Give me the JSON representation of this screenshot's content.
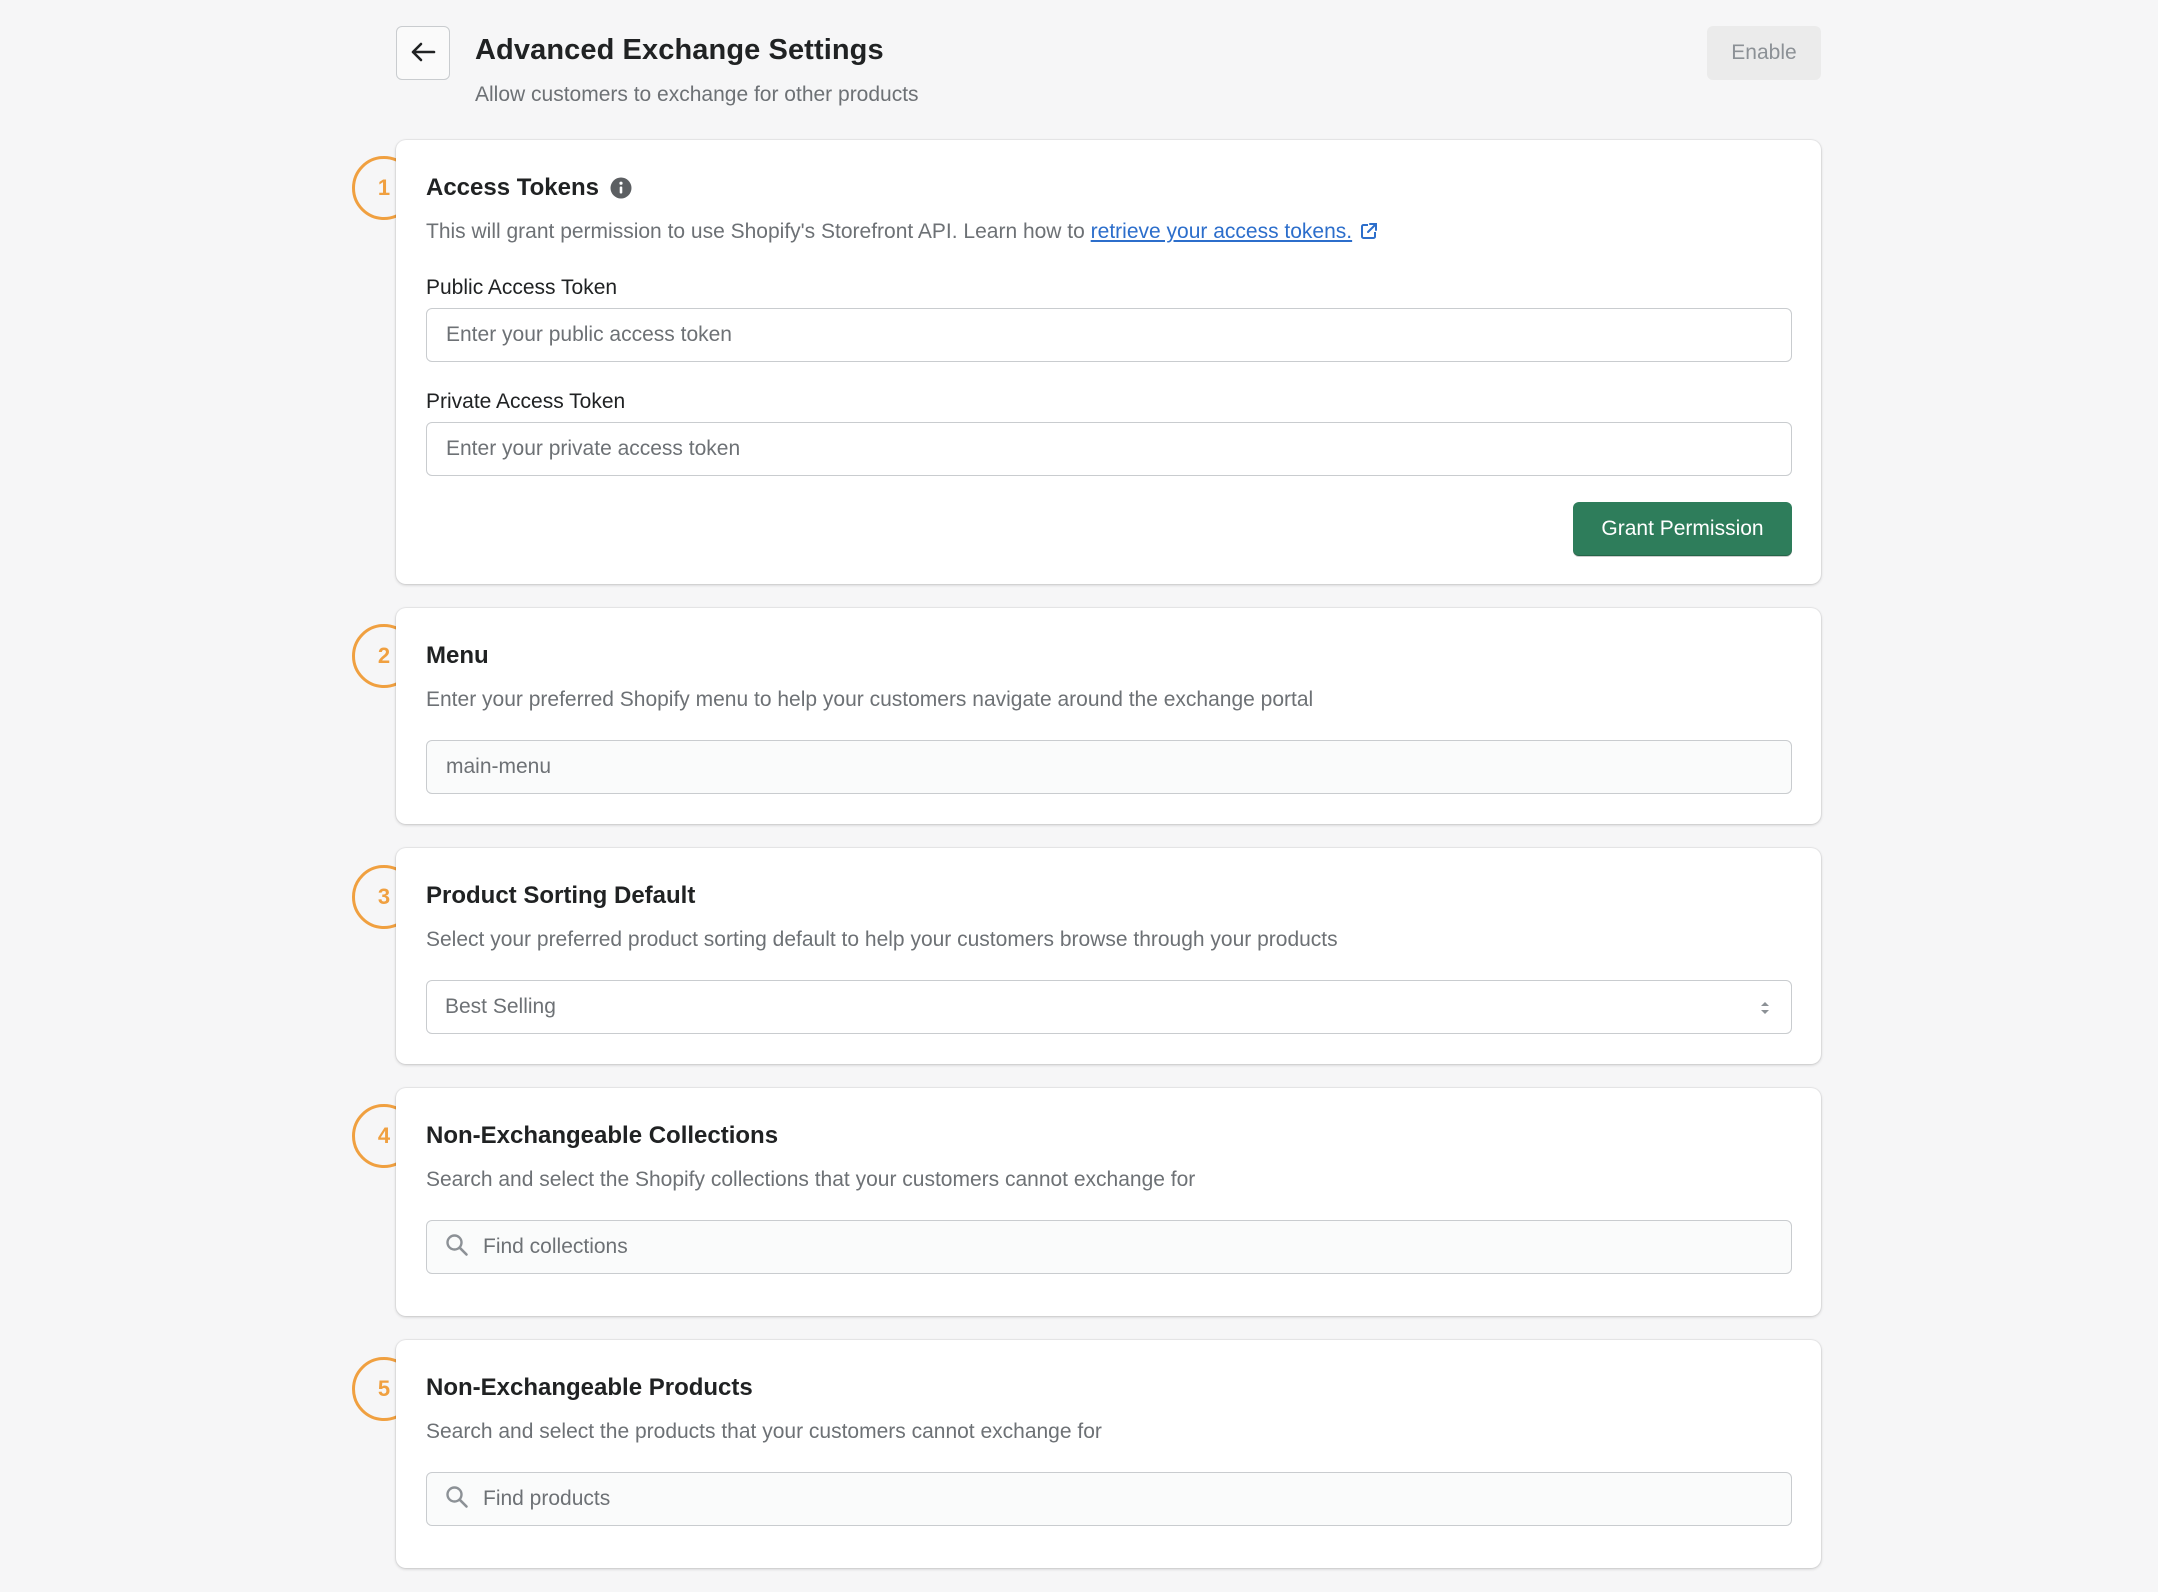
{
  "header": {
    "title": "Advanced Exchange Settings",
    "subtitle": "Allow customers to exchange for other products",
    "enable_label": "Enable"
  },
  "colors": {
    "accent_orange": "#f0a040",
    "primary_green": "#2e7d5b",
    "link_blue": "#2c6ecb"
  },
  "icons": {
    "back": "arrow-left-icon",
    "info": "info-icon",
    "external": "external-link-icon",
    "search": "search-icon",
    "select": "select-chevron-icon"
  },
  "sections": {
    "access_tokens": {
      "step": "1",
      "title": "Access Tokens",
      "desc_prefix": "This will grant permission to use Shopify's Storefront API. Learn how to ",
      "desc_link": "retrieve your access tokens.",
      "public_label": "Public Access Token",
      "public_placeholder": "Enter your public access token",
      "private_label": "Private Access Token",
      "private_placeholder": "Enter your private access token",
      "grant_label": "Grant Permission"
    },
    "menu": {
      "step": "2",
      "title": "Menu",
      "desc": "Enter your preferred Shopify menu to help your customers navigate around the exchange portal",
      "placeholder": "main-menu"
    },
    "sorting": {
      "step": "3",
      "title": "Product Sorting Default",
      "desc": "Select your preferred product sorting default to help your customers browse through your products",
      "selected": "Best Selling"
    },
    "collections": {
      "step": "4",
      "title": "Non-Exchangeable Collections",
      "desc": "Search and select the Shopify collections that your customers cannot exchange for",
      "placeholder": "Find collections"
    },
    "products": {
      "step": "5",
      "title": "Non-Exchangeable Products",
      "desc": "Search and select the products that your customers cannot exchange for",
      "placeholder": "Find products"
    }
  }
}
